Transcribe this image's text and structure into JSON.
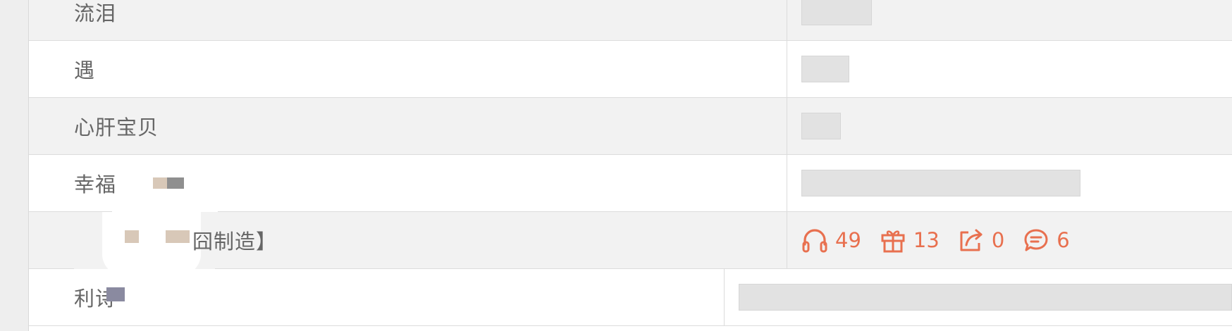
{
  "rows": [
    {
      "title": "流泪"
    },
    {
      "title": "遇"
    },
    {
      "title": "心肝宝贝"
    },
    {
      "title": "幸福"
    },
    {
      "title": "囧制造】"
    },
    {
      "title": "利诗"
    }
  ],
  "stats": {
    "plays": "49",
    "gifts": "13",
    "shares": "0",
    "comments": "6"
  },
  "colors": {
    "accent": "#e8704f",
    "row_alt": "#f2f2f2",
    "placeholder": "#e2e2e2"
  },
  "icons": [
    "headphones-icon",
    "gift-icon",
    "share-icon",
    "comment-icon"
  ]
}
